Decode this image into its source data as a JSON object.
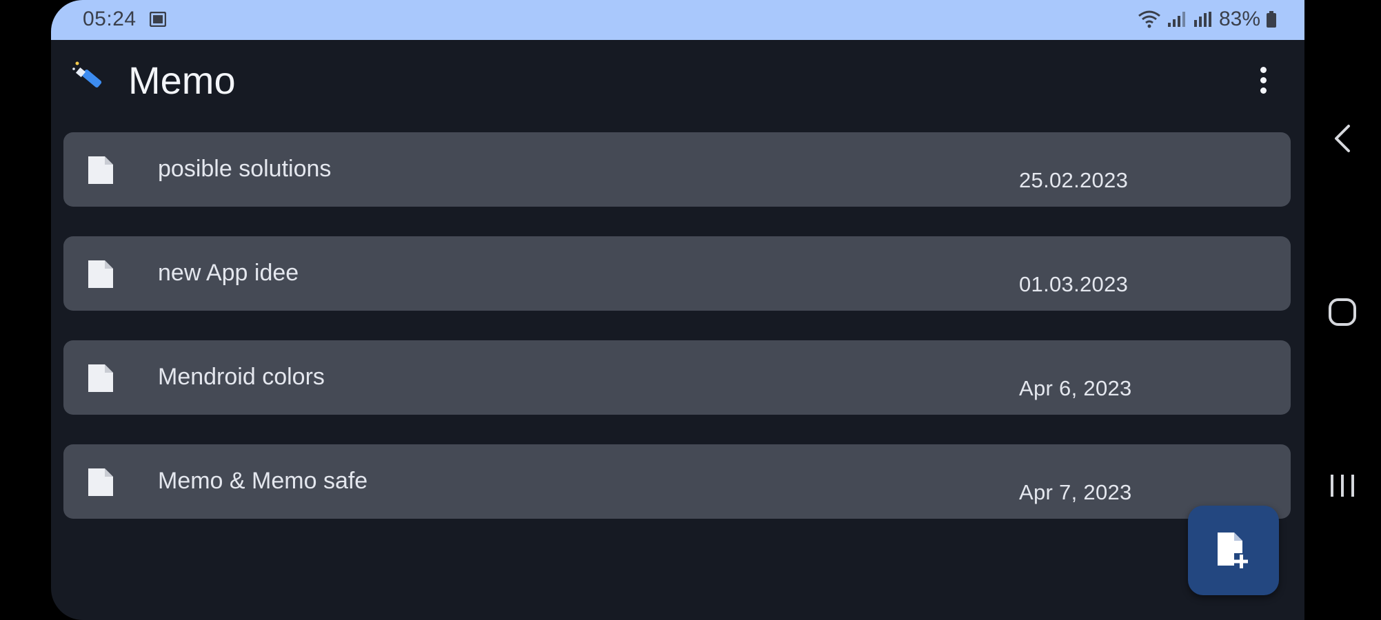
{
  "status_bar": {
    "time": "05:24",
    "battery": "83%"
  },
  "app_bar": {
    "title": "Memo",
    "logo_icon": "pen-icon",
    "menu_icon": "more-vert-icon"
  },
  "notes": [
    {
      "title": "posible solutions",
      "date": "25.02.2023"
    },
    {
      "title": "new App idee",
      "date": "01.03.2023"
    },
    {
      "title": "Mendroid colors",
      "date": "Apr 6, 2023"
    },
    {
      "title": "Memo & Memo safe",
      "date": "Apr 7, 2023"
    }
  ],
  "fab": {
    "icon": "add-note-icon"
  },
  "nav": {
    "back_icon": "back-chevron-icon",
    "home_icon": "home-icon",
    "recents_icon": "recents-icon"
  },
  "colors": {
    "background": "#161a23",
    "status_bar": "#a9c8fc",
    "card": "#454a55",
    "fab": "#234780",
    "accent": "#3d8cf0"
  }
}
